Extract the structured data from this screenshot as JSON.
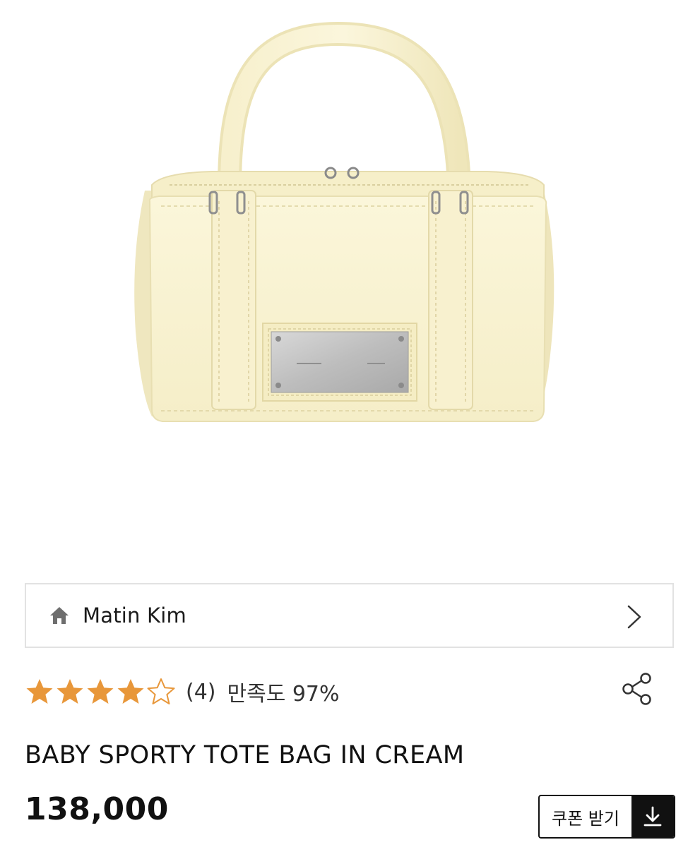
{
  "brand": {
    "name": "Matin Kim",
    "home_icon": "home-icon",
    "chevron_icon": "chevron-right-icon"
  },
  "rating": {
    "value": 4.5,
    "max": 5,
    "filled_color": "#e8973a",
    "review_count": "(4)",
    "satisfaction": "만족도 97%"
  },
  "share": {
    "icon": "share-icon"
  },
  "product": {
    "title": "BABY SPORTY TOTE BAG IN CREAM",
    "price": "138,000",
    "image_alt": "cream leather mini tote bag"
  },
  "coupon": {
    "label": "쿠폰 받기",
    "icon": "download-icon"
  },
  "colors": {
    "border": "#e2e2e2",
    "text": "#111111",
    "star": "#e8973a"
  }
}
